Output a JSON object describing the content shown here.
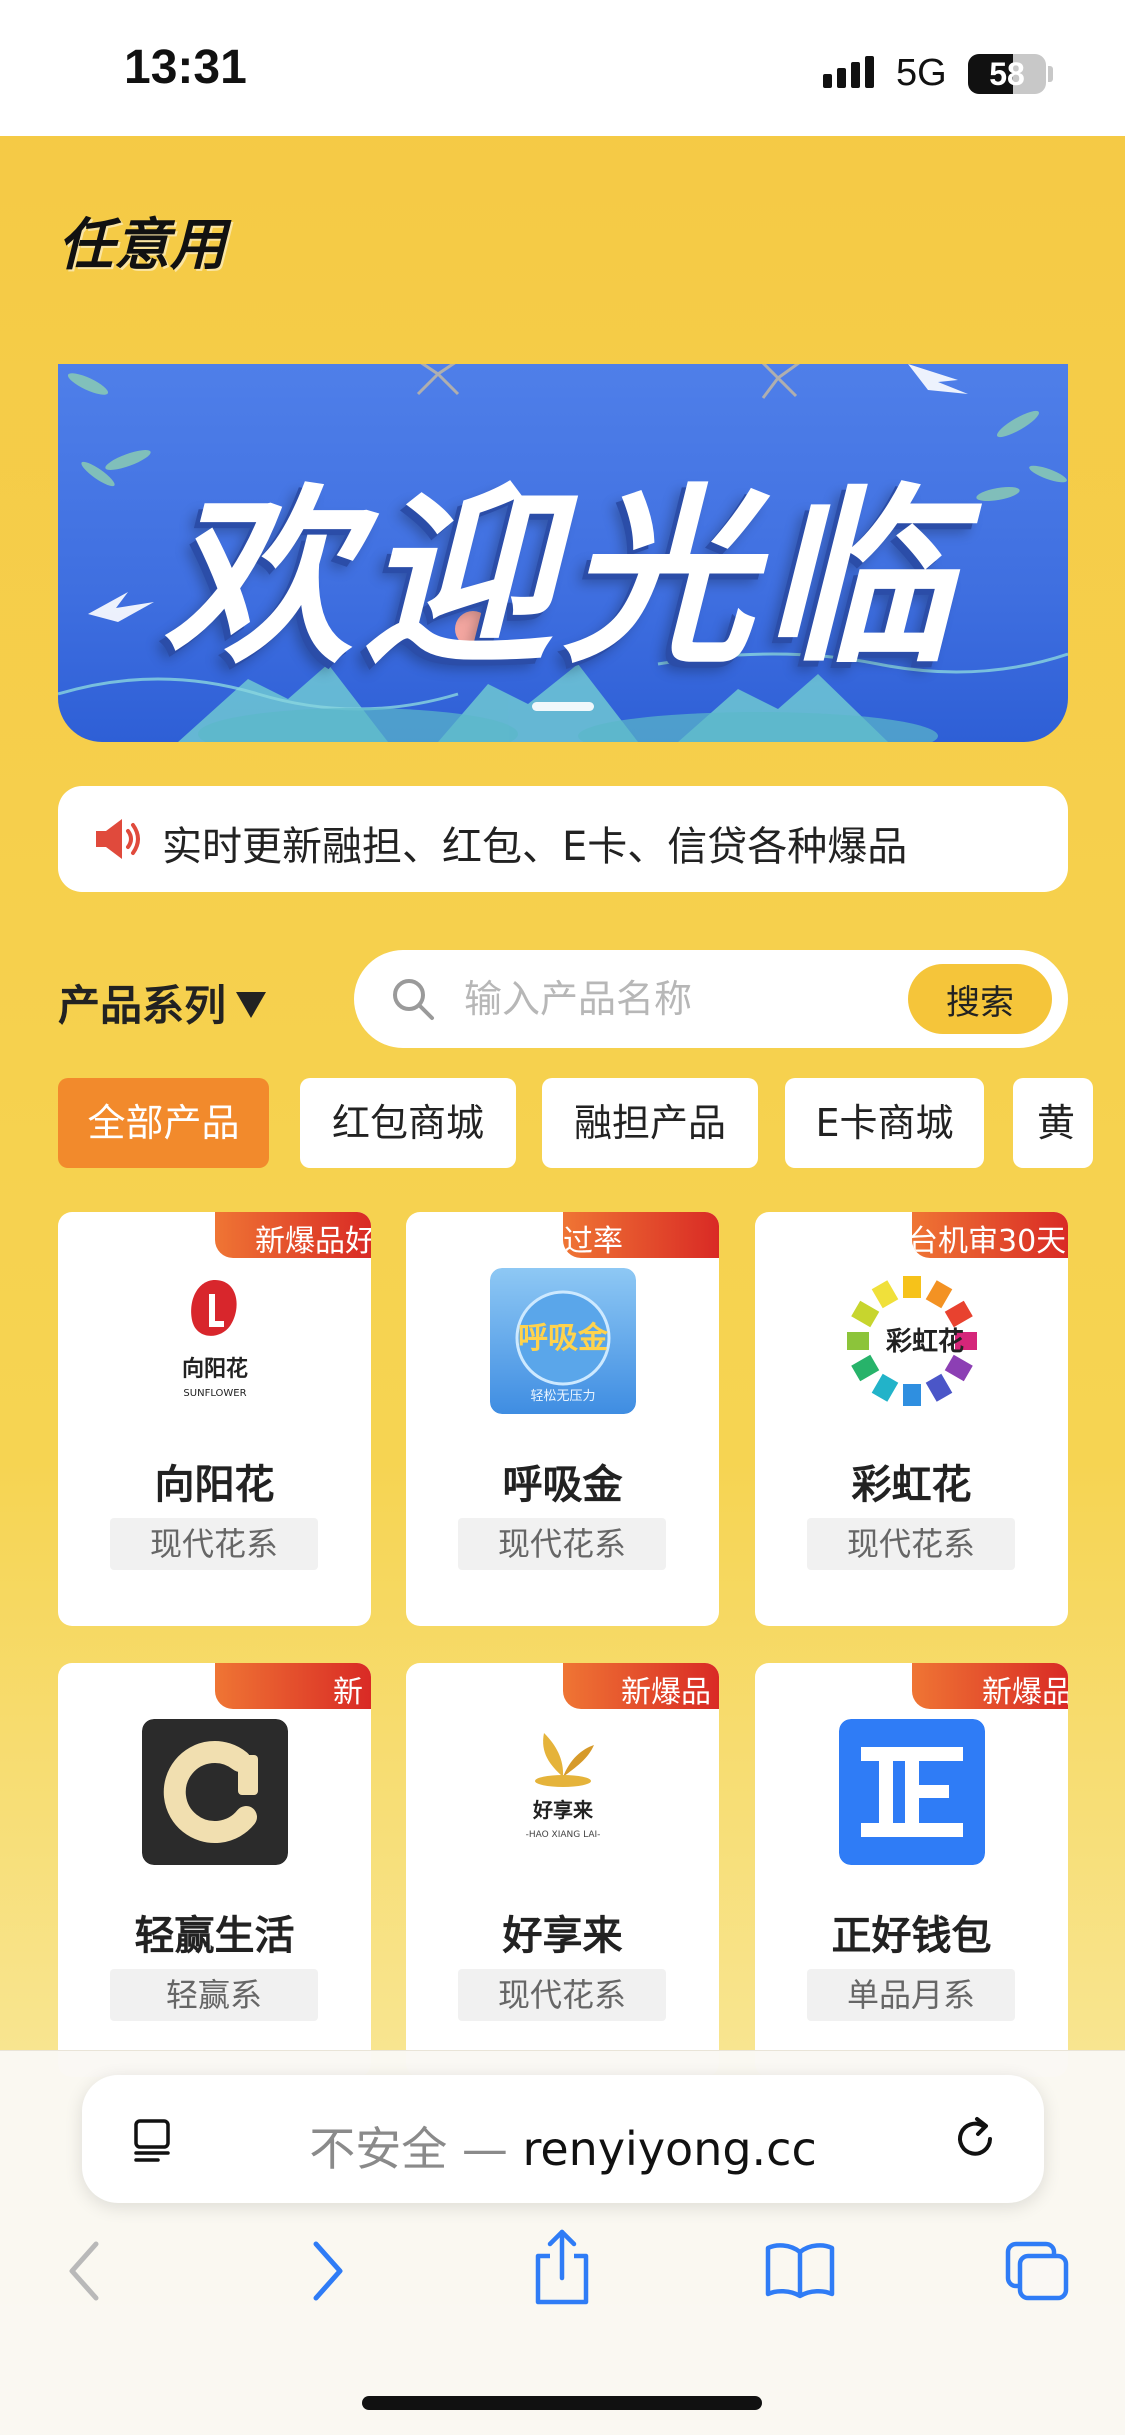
{
  "status_bar": {
    "time": "13:31",
    "network": "5G",
    "battery": "58",
    "battery_level": 0.58
  },
  "site": {
    "title": "任意用"
  },
  "banner": {
    "text": "欢迎光临"
  },
  "notice": {
    "icon": "speaker-icon",
    "text": "实时更新融担、红包、E卡、信贷各种爆品"
  },
  "filter": {
    "category_label": "产品系列",
    "search_placeholder": "输入产品名称",
    "search_button": "搜索"
  },
  "tabs": [
    {
      "label": "全部产品",
      "active": true
    },
    {
      "label": "红包商城",
      "active": false
    },
    {
      "label": "融担产品",
      "active": false
    },
    {
      "label": "E卡商城",
      "active": false
    },
    {
      "label": "黄",
      "active": false
    }
  ],
  "products": [
    {
      "name": "向阳花",
      "tag": "现代花系",
      "badge": "新爆品好",
      "logo": "sunflower-logo",
      "logo_text": "向阳花",
      "logo_subtext": "SUNFLOWER"
    },
    {
      "name": "呼吸金",
      "tag": "现代花系",
      "badge": "过率",
      "logo": "huxijin-logo",
      "logo_text": "呼吸金",
      "logo_subtext": "轻松无压力"
    },
    {
      "name": "彩虹花",
      "tag": "现代花系",
      "badge": "台机审30天",
      "logo": "rainbow-logo",
      "logo_text": "彩虹花",
      "logo_subtext": ""
    },
    {
      "name": "轻赢生活",
      "tag": "轻赢系",
      "badge": "新",
      "logo": "qingying-logo",
      "logo_text": "",
      "logo_subtext": ""
    },
    {
      "name": "好享来",
      "tag": "现代花系",
      "badge": "新爆品",
      "logo": "haoxianglai-logo",
      "logo_text": "好享来",
      "logo_subtext": "-HAO XIANG LAI-"
    },
    {
      "name": "正好钱包",
      "tag": "单品月系",
      "badge": "新爆品",
      "logo": "zhenghao-logo",
      "logo_text": "",
      "logo_subtext": ""
    }
  ],
  "browser": {
    "insecure_label": "不安全 —",
    "domain": "renyiyong.cc"
  },
  "colors": {
    "page_yellow": "#f5c944",
    "accent_orange": "#f28a2c",
    "badge_red": "#d92a25",
    "banner_blue": "#4f7fe9",
    "ios_blue": "#2f7cf6"
  }
}
